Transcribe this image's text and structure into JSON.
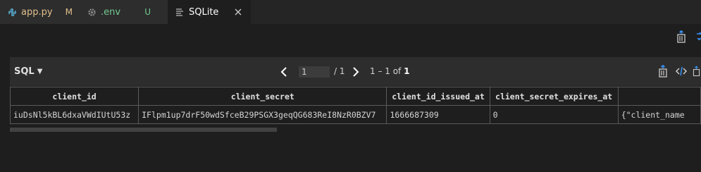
{
  "tabs": [
    {
      "name": "app.py",
      "status": "M",
      "icon": "python-icon"
    },
    {
      "name": ".env",
      "status": "U",
      "icon": "gear-icon"
    },
    {
      "name": "SQLite",
      "icon": "lines-icon",
      "close_icon": "close-icon"
    }
  ],
  "toolbar": {
    "language": "SQL",
    "current_page": "1",
    "page_total": "/ 1",
    "row_range": "1 – 1 of",
    "row_count": "1"
  },
  "table": {
    "columns": [
      "client_id",
      "client_secret",
      "client_id_issued_at",
      "client_secret_expires_at",
      ""
    ],
    "rows": [
      [
        "iuDsNl5kBL6dxaVWdIUtU53z",
        "IFlpm1up7drF50wdSfceB29PSGX3geqQG683ReI8NzR0BZV7",
        "1666687309",
        "0",
        "{\"client_name"
      ]
    ]
  },
  "colors": {
    "modified": "#e2c08d",
    "untracked": "#73c991",
    "accent_icon": "#3794ff"
  }
}
